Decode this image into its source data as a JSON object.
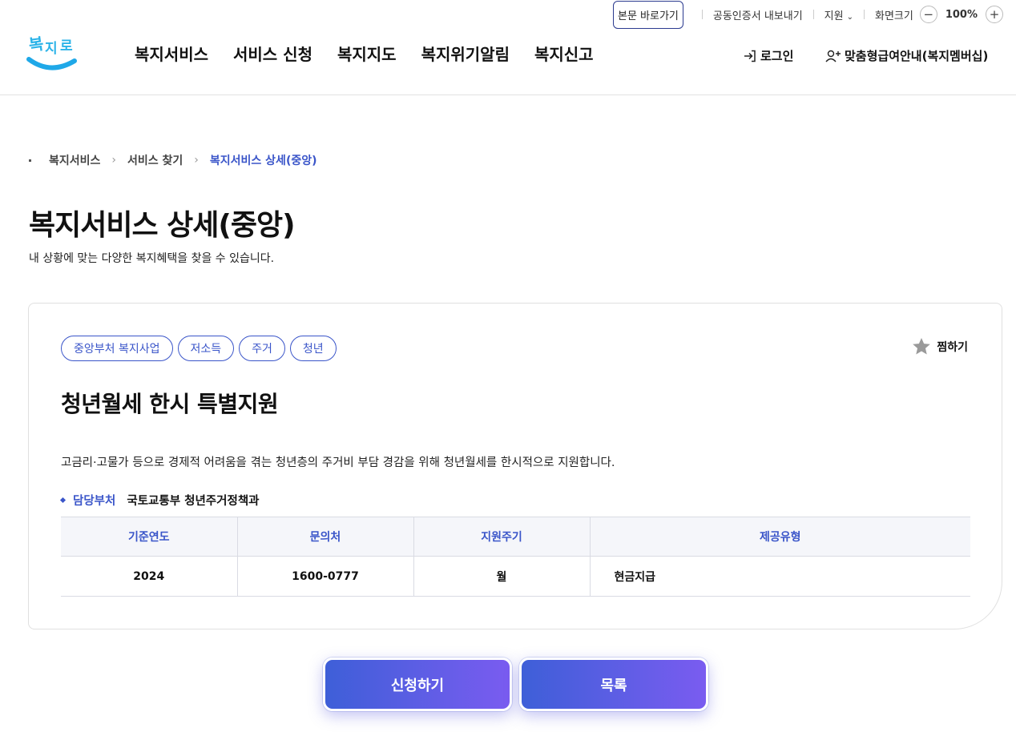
{
  "utility": {
    "skip_link": "본문 바로가기",
    "cert_export": "공동인증서 내보내기",
    "support": "지원",
    "screen_size": "화면크기",
    "zoom": "100%"
  },
  "header": {
    "logo_text": "복지로",
    "nav": [
      "복지서비스",
      "서비스 신청",
      "복지지도",
      "복지위기알림",
      "복지신고"
    ],
    "login": "로그인",
    "membership": "맞춤형급여안내(복지멤버십)"
  },
  "breadcrumb": [
    "복지서비스",
    "서비스 찾기",
    "복지서비스 상세(중앙)"
  ],
  "page": {
    "title": "복지서비스 상세(중앙)",
    "subtitle": "내 상황에 맞는 다양한 복지혜택을 찾을 수 있습니다."
  },
  "service": {
    "tags": [
      "중앙부처 복지사업",
      "저소득",
      "주거",
      "청년"
    ],
    "favorite": "찜하기",
    "title": "청년월세 한시 특별지원",
    "description": "고금리·고물가 등으로 경제적 어려움을 겪는 청년층의 주거비 부담 경감을 위해 청년월세를 한시적으로 지원합니다.",
    "dept_label": "담당부처",
    "dept_value": "국토교통부 청년주거정책과",
    "table": {
      "headers": [
        "기준연도",
        "문의처",
        "지원주기",
        "제공유형"
      ],
      "row": [
        "2024",
        "1600-0777",
        "월",
        "현금지급"
      ]
    }
  },
  "actions": {
    "apply": "신청하기",
    "list": "목록"
  },
  "colors": {
    "accent": "#3a55c9",
    "button_start": "#3e5fd8",
    "button_end": "#7a5cf0",
    "logo_blue": "#1fa8e8"
  },
  "icons": {
    "login": "login-icon",
    "member": "user-plus-icon",
    "favorite": "star-icon",
    "zoom_out": "minus-icon",
    "zoom_in": "plus-icon"
  }
}
